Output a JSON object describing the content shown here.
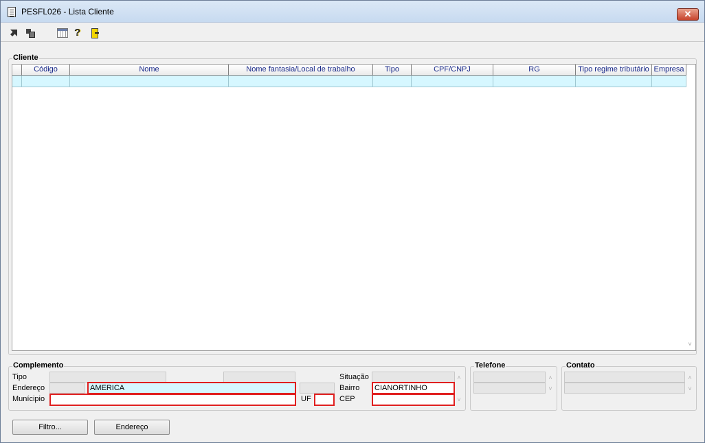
{
  "window": {
    "title": "PESFL026 - Lista Cliente",
    "close_label": "✕"
  },
  "toolbar": {
    "help_label": "?"
  },
  "cliente": {
    "label": "Cliente",
    "columns": [
      "Código",
      "Nome",
      "Nome fantasia/Local de trabalho",
      "Tipo",
      "CPF/CNPJ",
      "RG",
      "Tipo regime tributário",
      "Empresa"
    ],
    "scroll_glyph": "˅"
  },
  "complemento": {
    "label": "Complemento",
    "tipo_label": "Tipo",
    "endereco_label": "Endereço",
    "endereco_value": "AMERICA",
    "municipio_label": "Munícipio",
    "municipio_value": "",
    "uf_label": "UF",
    "uf_value": "",
    "situacao_label": "Situação",
    "bairro_label": "Bairro",
    "bairro_value": "CIANORTINHO",
    "cep_label": "CEP",
    "cep_value": "",
    "scroll_up": "˄",
    "scroll_down": "˅"
  },
  "telefone": {
    "label": "Telefone",
    "scroll_up": "˄",
    "scroll_down": "˅"
  },
  "contato": {
    "label": "Contato",
    "scroll_up": "˄",
    "scroll_down": "˅"
  },
  "buttons": {
    "filtro": "Filtro...",
    "endereco": "Endereço"
  }
}
